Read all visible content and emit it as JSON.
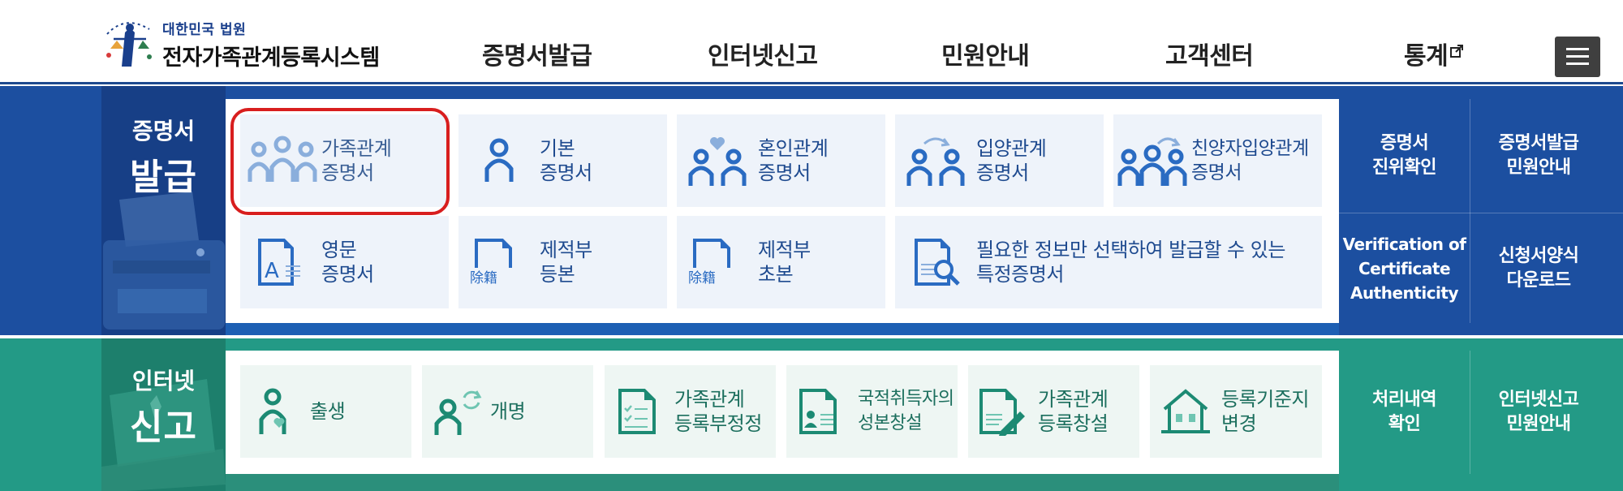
{
  "header": {
    "logo_small": "대한민국 법원",
    "logo_big": "전자가족관계등록시스템",
    "nav": [
      "증명서발급",
      "인터넷신고",
      "민원안내",
      "고객센터",
      "통계"
    ]
  },
  "certificate": {
    "label_line1": "증명서",
    "label_line2": "발급",
    "row1": [
      {
        "line1": "가족관계",
        "line2": "증명서"
      },
      {
        "line1": "기본",
        "line2": "증명서"
      },
      {
        "line1": "혼인관계",
        "line2": "증명서"
      },
      {
        "line1": "입양관계",
        "line2": "증명서"
      },
      {
        "line1": "친양자입양관계",
        "line2": "증명서"
      }
    ],
    "row2": [
      {
        "line1": "영문",
        "line2": "증명서"
      },
      {
        "line1": "제적부",
        "line2": "등본"
      },
      {
        "line1": "제적부",
        "line2": "초본"
      },
      {
        "line1": "필요한 정보만 선택하여 발급할 수 있는",
        "line2": "특정증명서"
      }
    ],
    "side": [
      {
        "line1": "증명서",
        "line2": "진위확인"
      },
      {
        "line1": "증명서발급",
        "line2": "민원안내"
      },
      {
        "line1": "Verification of",
        "line2": "Certificate",
        "line3": "Authenticity"
      },
      {
        "line1": "신청서양식",
        "line2": "다운로드"
      }
    ]
  },
  "report": {
    "label_line1": "인터넷",
    "label_line2": "신고",
    "tiles": [
      {
        "line1": "출생",
        "line2": ""
      },
      {
        "line1": "개명",
        "line2": ""
      },
      {
        "line1": "가족관계",
        "line2": "등록부정정"
      },
      {
        "line1": "국적취득자의",
        "line2": "성본창설"
      },
      {
        "line1": "가족관계",
        "line2": "등록창설"
      },
      {
        "line1": "등록기준지",
        "line2": "변경"
      }
    ],
    "side": [
      {
        "line1": "처리내역",
        "line2": "확인"
      },
      {
        "line1": "인터넷신고",
        "line2": "민원안내"
      }
    ]
  },
  "glyphs": {
    "hanja_removal": "除籍",
    "letter_a": "A"
  },
  "colors": {
    "cert_band": "#1c4fa0",
    "report_band": "#239a86",
    "highlight": "#d81e1e",
    "cert_text": "#1e4a8f",
    "report_text": "#1c6f5e"
  }
}
